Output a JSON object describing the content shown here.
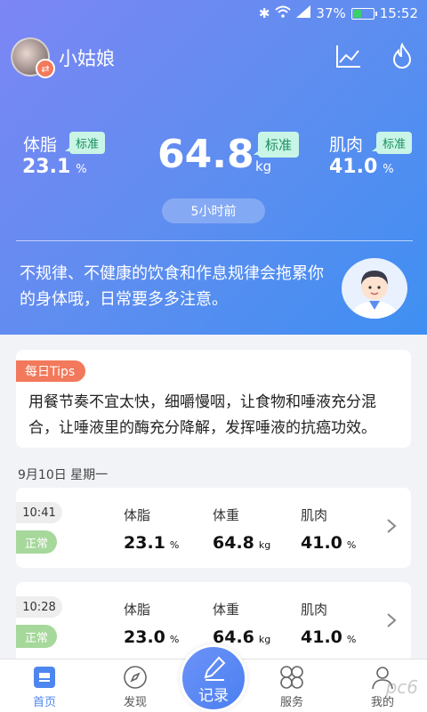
{
  "status_bar": {
    "battery_percent": "37%",
    "time": "15:52",
    "battery_level": 0.37
  },
  "profile": {
    "username": "小姑娘"
  },
  "summary": {
    "body_fat": {
      "label": "体脂",
      "value": "23.1",
      "unit": "%",
      "badge": "标准"
    },
    "weight": {
      "value": "64.8",
      "unit": "kg",
      "badge": "标准"
    },
    "muscle": {
      "label": "肌肉",
      "value": "41.0",
      "unit": "%",
      "badge": "标准"
    },
    "time_ago": "5小时前"
  },
  "advice": "不规律、不健康的饮食和作息规律会拖累你的身体哦，日常要多多注意。",
  "tips": {
    "tag": "每日Tips",
    "text": "用餐节奏不宜太快，细嚼慢咽，让食物和唾液充分混合，让唾液里的酶充分降解，发挥唾液的抗癌功效。"
  },
  "date_header": "9月10日 星期一",
  "records": [
    {
      "time": "10:41",
      "status": "正常",
      "fat_label": "体脂",
      "fat": "23.1",
      "fat_unit": "%",
      "weight_label": "体重",
      "weight": "64.8",
      "weight_unit": "kg",
      "muscle_label": "肌肉",
      "muscle": "41.0",
      "muscle_unit": "%"
    },
    {
      "time": "10:28",
      "status": "正常",
      "fat_label": "体脂",
      "fat": "23.0",
      "fat_unit": "%",
      "weight_label": "体重",
      "weight": "64.6",
      "weight_unit": "kg",
      "muscle_label": "肌肉",
      "muscle": "41.0",
      "muscle_unit": "%"
    }
  ],
  "tabs": {
    "home": "首页",
    "discover": "发现",
    "record": "记录",
    "service": "服务",
    "mine": "我的"
  },
  "watermark": "pc6",
  "colors": {
    "accent": "#4e86f0",
    "tips_tag": "#f2795b",
    "status_normal": "#a6d89b",
    "badge_bg": "#c9f5e7"
  }
}
